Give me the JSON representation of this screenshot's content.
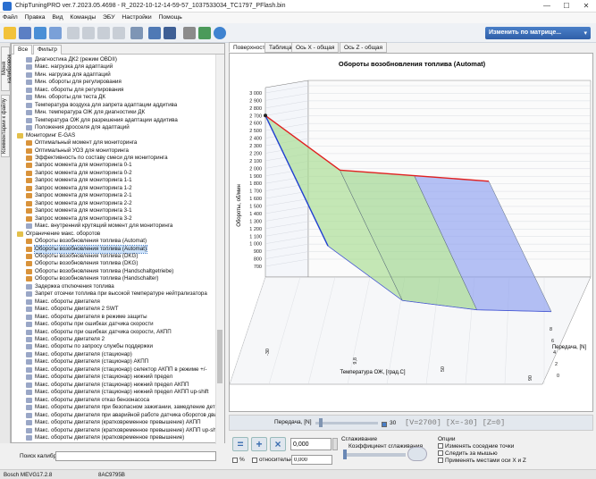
{
  "window": {
    "title": "ChipTuningPRO ver.7.2023.05.4698 - R_2022-10-12-14-59-57_1037533034_TC1797_PFlash.bin",
    "minimize": "—",
    "maximize": "☐",
    "close": "✕"
  },
  "menu": [
    "Файл",
    "Правка",
    "Вид",
    "Команды",
    "ЭБУ",
    "Настройки",
    "Помощь"
  ],
  "toolbar": {
    "matrix_button": "Изменить по матрице..."
  },
  "left_vertical_tabs": [
    "Меня калибровок",
    "Комментарии к файлу"
  ],
  "tree_tabs": [
    "Все",
    "Фильтр"
  ],
  "tree": [
    {
      "label": "Диагностика ДК2 (режим OBDII)",
      "indent": 2,
      "icon": "table"
    },
    {
      "label": "Макс. нагрузка для адаптаций",
      "indent": 2,
      "icon": "table"
    },
    {
      "label": "Мин. нагрузка для адаптаций",
      "indent": 2,
      "icon": "table"
    },
    {
      "label": "Мин. обороты для регулирования",
      "indent": 2,
      "icon": "table"
    },
    {
      "label": "Макс. обороты для регулирования",
      "indent": 2,
      "icon": "table"
    },
    {
      "label": "Мин. обороты для теста ДК",
      "indent": 2,
      "icon": "table"
    },
    {
      "label": "Температура воздуха для запрета адаптации аддитива",
      "indent": 2,
      "icon": "table"
    },
    {
      "label": "Мин. температура ОЖ для диагностики ДК",
      "indent": 2,
      "icon": "table"
    },
    {
      "label": "Температура ОЖ для разрешения адаптации аддитива",
      "indent": 2,
      "icon": "table"
    },
    {
      "label": "Положения дросселя для адаптаций",
      "indent": 2,
      "icon": "table"
    },
    {
      "label": "Мониторинг E-GAS",
      "indent": 1,
      "icon": "folder"
    },
    {
      "label": "Оптимальный момент для мониторинга",
      "indent": 2,
      "icon": "chart"
    },
    {
      "label": "Оптимальный УОЗ для мониторинга",
      "indent": 2,
      "icon": "chart"
    },
    {
      "label": "Эффективность по составу смеси для мониторинга",
      "indent": 2,
      "icon": "chart"
    },
    {
      "label": "Запрос момента для мониторинга 0-1",
      "indent": 2,
      "icon": "chart"
    },
    {
      "label": "Запрос момента для мониторинга 0-2",
      "indent": 2,
      "icon": "chart"
    },
    {
      "label": "Запрос момента для мониторинга 1-1",
      "indent": 2,
      "icon": "chart"
    },
    {
      "label": "Запрос момента для мониторинга 1-2",
      "indent": 2,
      "icon": "chart"
    },
    {
      "label": "Запрос момента для мониторинга 2-1",
      "indent": 2,
      "icon": "chart"
    },
    {
      "label": "Запрос момента для мониторинга 2-2",
      "indent": 2,
      "icon": "chart"
    },
    {
      "label": "Запрос момента для мониторинга 3-1",
      "indent": 2,
      "icon": "chart"
    },
    {
      "label": "Запрос момента для мониторинга 3-2",
      "indent": 2,
      "icon": "chart"
    },
    {
      "label": "Макс. внутренний крутящий момент для мониторинга",
      "indent": 2,
      "icon": "table"
    },
    {
      "label": "Ограничение макс. оборотов",
      "indent": 1,
      "icon": "folder"
    },
    {
      "label": "Обороты возобновления топлива (Automat)",
      "indent": 2,
      "icon": "chart"
    },
    {
      "label": "Обороты возобновления топлива (Automat)",
      "indent": 2,
      "icon": "chart",
      "selected": true
    },
    {
      "label": "Обороты возобновления топлива (DKG)",
      "indent": 2,
      "icon": "chart"
    },
    {
      "label": "Обороты возобновления топлива (DKG)",
      "indent": 2,
      "icon": "chart"
    },
    {
      "label": "Обороты возобновления топлива (Handschaltgetriebe)",
      "indent": 2,
      "icon": "chart"
    },
    {
      "label": "Обороты возобновления топлива (Handschalter)",
      "indent": 2,
      "icon": "chart"
    },
    {
      "label": "Задержка отключения топлива",
      "indent": 2,
      "icon": "table"
    },
    {
      "label": "Запрет отсечки топлива при высокой температуре нейтрализатора",
      "indent": 2,
      "icon": "table"
    },
    {
      "label": "Макс. обороты двигателя",
      "indent": 2,
      "icon": "table"
    },
    {
      "label": "Макс. обороты двигателя 2 SWT",
      "indent": 2,
      "icon": "table"
    },
    {
      "label": "Макс. обороты двигателя в режиме защиты",
      "indent": 2,
      "icon": "table"
    },
    {
      "label": "Макс. обороты при ошибках датчика скорости",
      "indent": 2,
      "icon": "table"
    },
    {
      "label": "Макс. обороты при ошибках датчика скорости, АКПП",
      "indent": 2,
      "icon": "table"
    },
    {
      "label": "Макс. обороты двигателя 2",
      "indent": 2,
      "icon": "table"
    },
    {
      "label": "Макс. обороты по запросу службы поддержки",
      "indent": 2,
      "icon": "table"
    },
    {
      "label": "Макс. обороты двигателя (стационар)",
      "indent": 2,
      "icon": "table"
    },
    {
      "label": "Макс. обороты двигателя (стационар) АКПП",
      "indent": 2,
      "icon": "table"
    },
    {
      "label": "Макс. обороты двигателя (стационар) селектор АКПП в режиме +/-",
      "indent": 2,
      "icon": "table"
    },
    {
      "label": "Макс. обороты двигателя (стационар) нижний предел",
      "indent": 2,
      "icon": "table"
    },
    {
      "label": "Макс. обороты двигателя (стационар) нижний предел АКПП",
      "indent": 2,
      "icon": "table"
    },
    {
      "label": "Макс. обороты двигателя (стационар) нижний предел АКПП up-shift",
      "indent": 2,
      "icon": "table"
    },
    {
      "label": "Макс. обороты двигателя отказ бензонасоса",
      "indent": 2,
      "icon": "table"
    },
    {
      "label": "Макс. обороты двигателя при безопасном зажигании, замедление детона",
      "indent": 2,
      "icon": "table"
    },
    {
      "label": "Макс. обороты двигателя при аварийной работе датчика оборотов двиг",
      "indent": 2,
      "icon": "table"
    },
    {
      "label": "Макс. обороты двигателя (кратковременное превышение) АКПП",
      "indent": 2,
      "icon": "table"
    },
    {
      "label": "Макс. обороты двигателя (кратковременное превышение) АКПП up-shift",
      "indent": 2,
      "icon": "table"
    },
    {
      "label": "Макс. обороты двигателя (кратковременное превышение)",
      "indent": 2,
      "icon": "table"
    }
  ],
  "search": {
    "label": "Поиск калибровки"
  },
  "view_tabs": [
    "Поверхность",
    "Таблица",
    "Ось X - общая",
    "Ось Z - общая"
  ],
  "chart_data": {
    "type": "surface3d",
    "title": "Обороты возобновления топлива (Automat)",
    "xlabel": "Температура ОЖ, [град.С]",
    "ylabel": "Обороты, об/мин",
    "zlabel": "Передача, [N]",
    "y_ticks": [
      "3 000",
      "2 900",
      "2 800",
      "2 700",
      "2 600",
      "2 500",
      "2 400",
      "2 300",
      "2 200",
      "2 100",
      "2 000",
      "1 900",
      "1 800",
      "1 700",
      "1 600",
      "1 500",
      "1 400",
      "1 300",
      "1 200",
      "1 100",
      "1 000",
      "900",
      "800",
      "700"
    ],
    "x_ticks": [
      "-30",
      "9,8",
      "50",
      "90"
    ],
    "z_ticks": [
      "0",
      "2",
      "4",
      "6",
      "8"
    ],
    "x": [
      -30,
      9.8,
      50,
      90
    ],
    "z": [
      0,
      2,
      4,
      6,
      8
    ],
    "series": [
      {
        "name": "Передача 0",
        "values": [
          2700,
          2000,
          1950,
          1900
        ]
      },
      {
        "name": "Передача 8",
        "values": [
          1800,
          1100,
          1000,
          1000
        ]
      }
    ]
  },
  "controls": {
    "gear_label": "Передача, [N]",
    "gear_value": "30",
    "readout": "[V=2700] [X=-30] [Z=0]",
    "value_input": "0,000",
    "value_input2": "0,000",
    "percent_label": "%",
    "relative_label": "относительно",
    "smoothing_title": "Сглаживание",
    "smoothing_coef_label": "Коэффициент сглаживания",
    "options_title": "Опции",
    "options": [
      "Изменять соседние точки",
      "Следить за мышью",
      "Применять местами оси X и Z"
    ]
  },
  "status": {
    "ecu": "Bosch MEVG17.2.8",
    "crc": "8AC9795B"
  },
  "colors": {
    "red_line": "#e02020",
    "blue_line": "#2040d0",
    "surface_green": "#8fd07a",
    "surface_blue": "#6070e8",
    "selection": "#cde3fb"
  }
}
